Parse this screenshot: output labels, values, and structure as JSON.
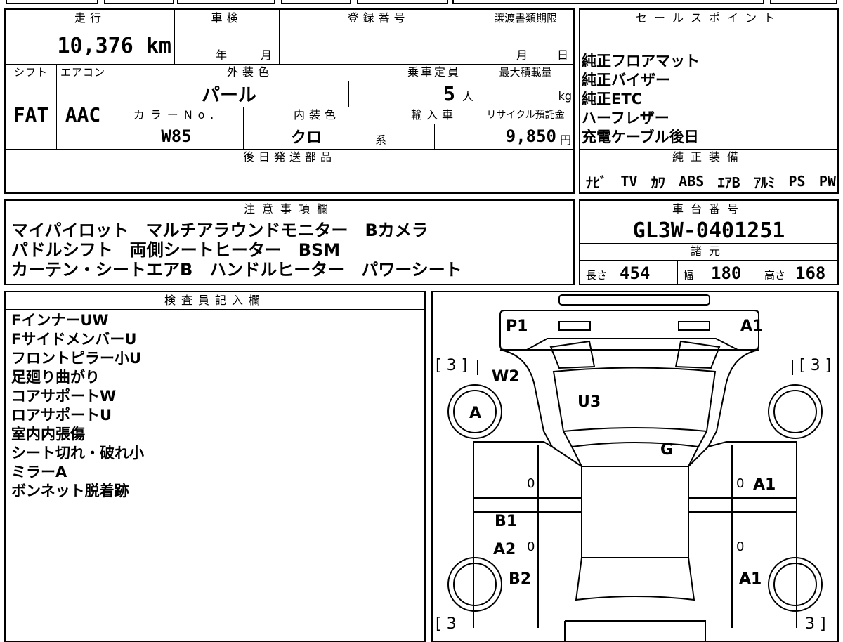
{
  "vehicle": {
    "mileage_label": "走行",
    "mileage": "10,376 km",
    "inspection_label": "車検",
    "inspection_year": "年",
    "inspection_month": "月",
    "registration_label": "登録番号",
    "transfer_label": "譲渡書類期限",
    "transfer_month": "月",
    "transfer_day": "日",
    "shift_label": "シフト",
    "shift": "FAT",
    "aircon_label": "エアコン",
    "aircon": "AAC",
    "exterior_color_label": "外装色",
    "exterior_color": "パール",
    "capacity_label": "乗車定員",
    "capacity": "5",
    "capacity_unit": "人",
    "max_load_label": "最大積載量",
    "max_load_unit": "kg",
    "color_no_label": "カラーNo.",
    "color_no": "W85",
    "interior_color_label": "内装色",
    "interior_color": "クロ",
    "interior_suffix": "系",
    "import_label": "輸入車",
    "recycle_label": "リサイクル預託金",
    "recycle_fee": "9,850",
    "recycle_unit": "円",
    "later_parts_label": "後日発送部品"
  },
  "sales_points": {
    "title": "セールスポイント",
    "items": [
      "純正フロアマット",
      "純正バイザー",
      "純正ETC",
      "ハーフレザー",
      "充電ケーブル後日"
    ]
  },
  "genuine_equipment": {
    "title": "純正装備",
    "items": [
      "ﾅﾋﾞ",
      "TV",
      "ｶﾜ",
      "ABS",
      "ｴｱB",
      "ｱﾙﾐ",
      "PS",
      "PW"
    ]
  },
  "notes": {
    "title": "注意事項欄",
    "lines": [
      "マイパイロット　マルチアラウンドモニター　Bカメラ",
      "パドルシフト　両側シートヒーター　BSM",
      "カーテン・シートエアB　ハンドルヒーター　パワーシート"
    ]
  },
  "chassis": {
    "title": "車台番号",
    "number": "GL3W-0401251"
  },
  "specs": {
    "title": "諸元",
    "length_label": "長さ",
    "length": "454",
    "width_label": "幅",
    "width": "180",
    "height_label": "高さ",
    "height": "168"
  },
  "inspector": {
    "title": "検査員記入欄",
    "lines": [
      "FインナーUW",
      "FサイドメンバーU",
      "フロントピラー小U",
      "足廻り曲がり",
      "コアサポートW",
      "ロアサポートU",
      "室内内張傷",
      "シート切れ・破れ小",
      "ミラーA",
      "ボンネット脱着跡"
    ]
  },
  "diagram": {
    "tread_tl": "[ 3 ]",
    "tread_tr": "[ 3 ]",
    "tread_bl": "[ 3",
    "tread_br": "3 ]",
    "p1": "P1",
    "a1_front": "A1",
    "w2": "W2",
    "u3": "U3",
    "a_wheel": "A",
    "g": "G",
    "a1_right": "A1",
    "b1": "B1",
    "a2": "A2",
    "b2": "B2",
    "a1_rear": "A1",
    "zero_1": "0",
    "zero_2": "0",
    "zero_3": "0",
    "zero_4": "0"
  }
}
